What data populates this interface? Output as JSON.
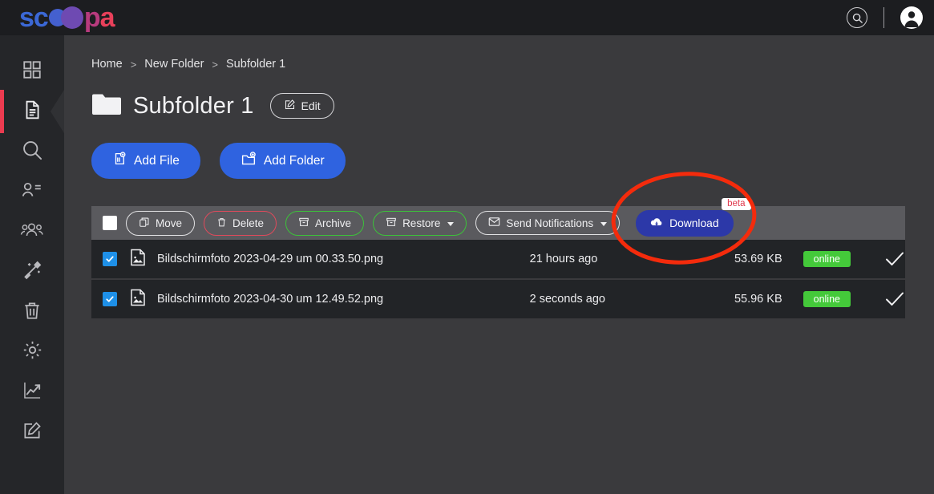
{
  "app": {
    "logo_part1": "sc",
    "logo_part2": "p",
    "logo_part3": "a",
    "accent_blue": "#2f63e0",
    "accent_red": "#ec3b50",
    "accent_green": "#44c93a",
    "download_blue": "#2c38a8"
  },
  "header": {
    "search_icon": "search-icon",
    "avatar_icon": "user-avatar-icon"
  },
  "sidebar": {
    "items": [
      {
        "name": "dashboard",
        "icon": "grid-icon",
        "active": false
      },
      {
        "name": "documents",
        "icon": "document-icon",
        "active": true
      },
      {
        "name": "search",
        "icon": "search-icon",
        "active": false
      },
      {
        "name": "contacts",
        "icon": "user-list-icon",
        "active": false
      },
      {
        "name": "groups",
        "icon": "users-group-icon",
        "active": false
      },
      {
        "name": "tools",
        "icon": "magic-wand-icon",
        "active": false
      },
      {
        "name": "trash",
        "icon": "trash-icon",
        "active": false
      },
      {
        "name": "settings",
        "icon": "gear-icon",
        "active": false
      },
      {
        "name": "analytics",
        "icon": "chart-line-icon",
        "active": false
      },
      {
        "name": "compose",
        "icon": "edit-square-icon",
        "active": false
      }
    ]
  },
  "breadcrumb": {
    "items": [
      "Home",
      "New Folder",
      "Subfolder 1"
    ],
    "separator": ">"
  },
  "page": {
    "title": "Subfolder 1",
    "folder_icon": "folder-icon",
    "edit_label": "Edit",
    "edit_icon": "pencil-icon"
  },
  "actions": {
    "add_file": "Add File",
    "add_file_icon": "file-plus-icon",
    "add_folder": "Add Folder",
    "add_folder_icon": "folder-plus-icon"
  },
  "toolbar": {
    "select_all_checked": false,
    "move": "Move",
    "move_icon": "move-copy-icon",
    "delete": "Delete",
    "delete_icon": "trash-icon",
    "archive": "Archive",
    "archive_icon": "archive-box-icon",
    "restore": "Restore",
    "restore_icon": "archive-box-icon",
    "send_notifications": "Send Notifications",
    "send_notifications_icon": "envelope-icon",
    "download": "Download",
    "download_icon": "cloud-download-icon",
    "beta_badge": "beta"
  },
  "files": [
    {
      "checked": true,
      "icon": "image-file-icon",
      "name": "Bildschirmfoto 2023-04-29 um 00.33.50.png",
      "modified": "21 hours ago",
      "size": "53.69 KB",
      "status": "online",
      "status_icon": "checkmark-icon"
    },
    {
      "checked": true,
      "icon": "image-file-icon",
      "name": "Bildschirmfoto 2023-04-30 um 12.49.52.png",
      "modified": "2 seconds ago",
      "size": "55.96 KB",
      "status": "online",
      "status_icon": "checkmark-icon"
    }
  ],
  "annotation": {
    "shape": "ellipse-highlight",
    "color": "#f42b0c",
    "target": "download-button"
  }
}
